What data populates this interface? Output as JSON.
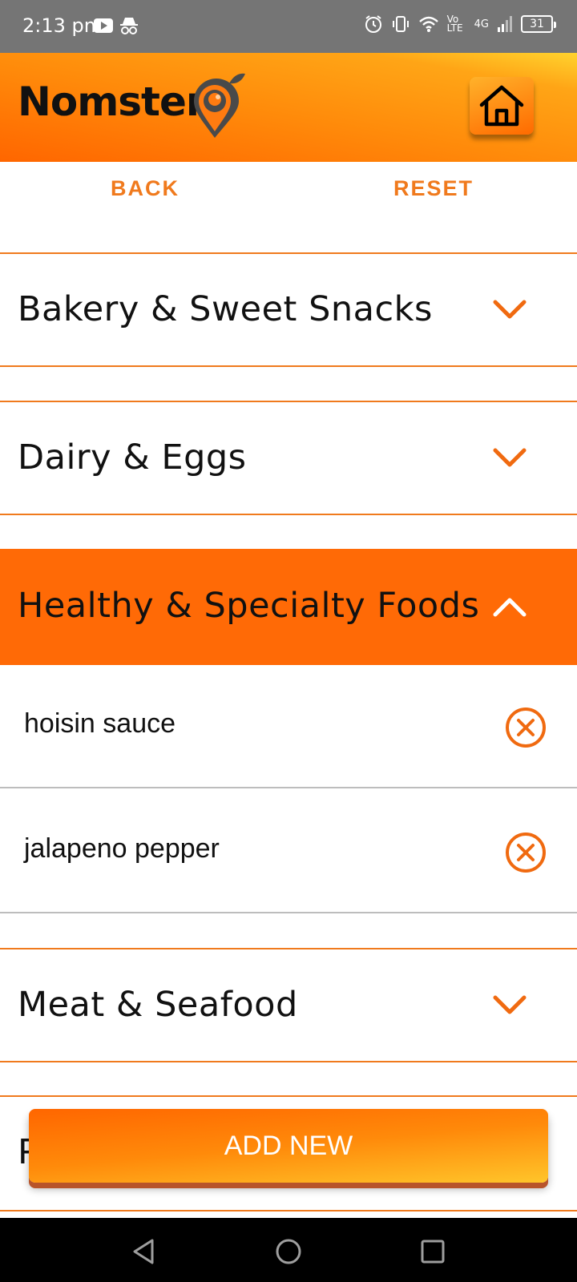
{
  "status_bar": {
    "time": "2:13 pm",
    "battery": "31",
    "network": "4G",
    "volte": "Vo LTE"
  },
  "header": {
    "app_name": "Nomster"
  },
  "actions": {
    "back_label": "BACK",
    "reset_label": "RESET"
  },
  "categories": [
    {
      "label": "Bakery & Sweet Snacks",
      "expanded": false
    },
    {
      "label": "Dairy & Eggs",
      "expanded": false
    },
    {
      "label": "Healthy & Specialty Foods",
      "expanded": true,
      "items": [
        {
          "label": "hoisin sauce"
        },
        {
          "label": "jalapeno pepper"
        }
      ]
    },
    {
      "label": "Meat & Seafood",
      "expanded": false
    },
    {
      "label": "P",
      "expanded": false
    }
  ],
  "add_new_label": "ADD NEW",
  "colors": {
    "accent": "#f07a1d",
    "header_orange": "#ff6a06",
    "header_yellow": "#ffd32e"
  }
}
